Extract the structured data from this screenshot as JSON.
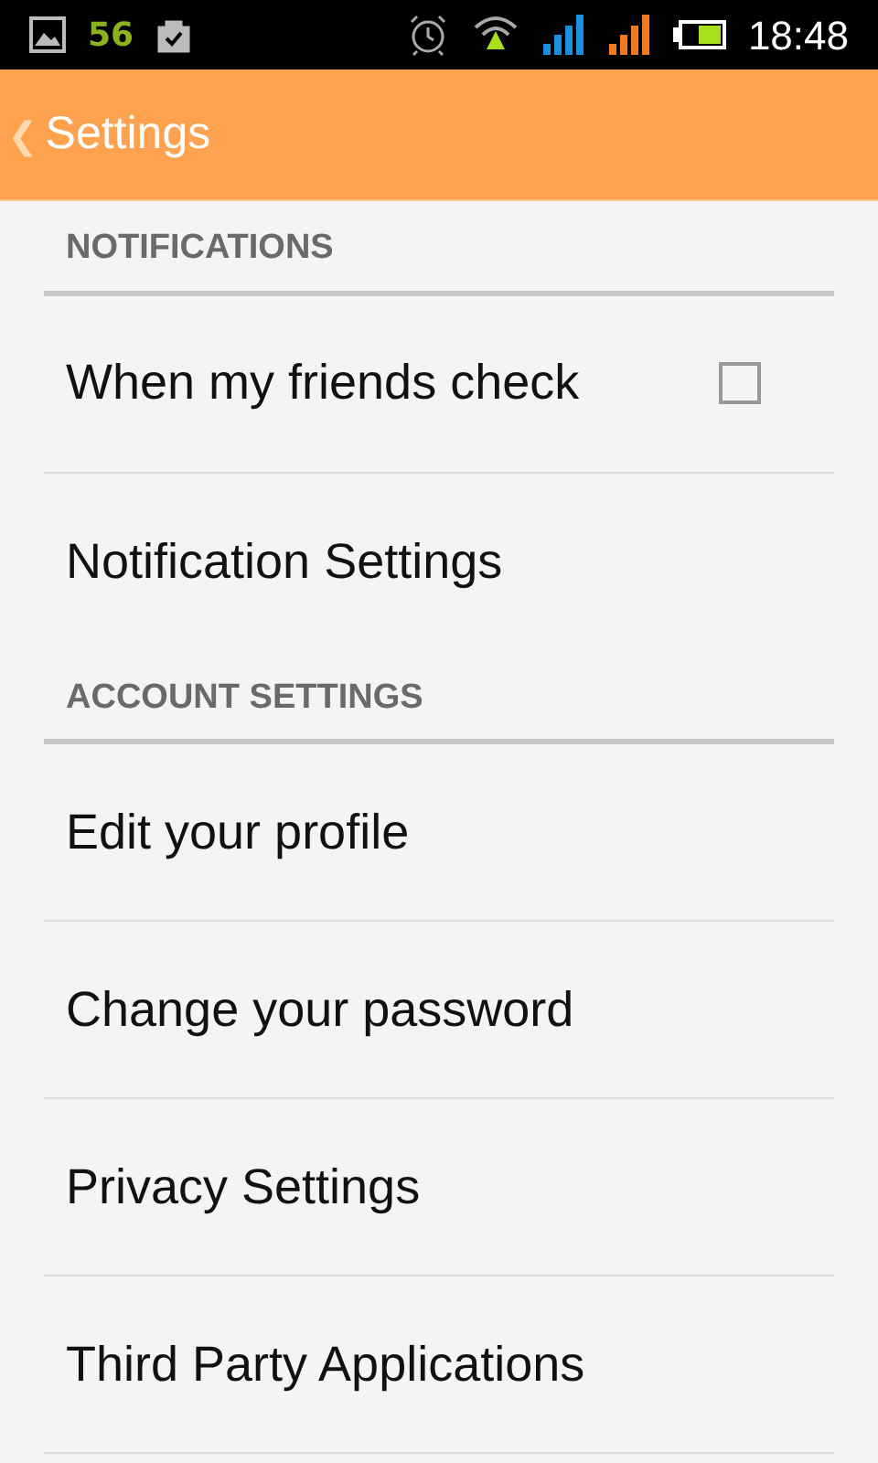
{
  "status_bar": {
    "notification_count": "56",
    "time": "18:48"
  },
  "action_bar": {
    "back_icon": "❮",
    "title": "Settings"
  },
  "sections": [
    {
      "title": "NOTIFICATIONS",
      "items": [
        {
          "label": "When my friends check",
          "kind": "checkbox",
          "checked": false
        },
        {
          "label": "Notification Settings",
          "kind": "link"
        }
      ]
    },
    {
      "title": "ACCOUNT SETTINGS",
      "items": [
        {
          "label": "Edit your profile",
          "kind": "link"
        },
        {
          "label": "Change your password",
          "kind": "link"
        },
        {
          "label": "Privacy Settings",
          "kind": "link"
        },
        {
          "label": "Third Party Applications",
          "kind": "link"
        }
      ]
    }
  ]
}
